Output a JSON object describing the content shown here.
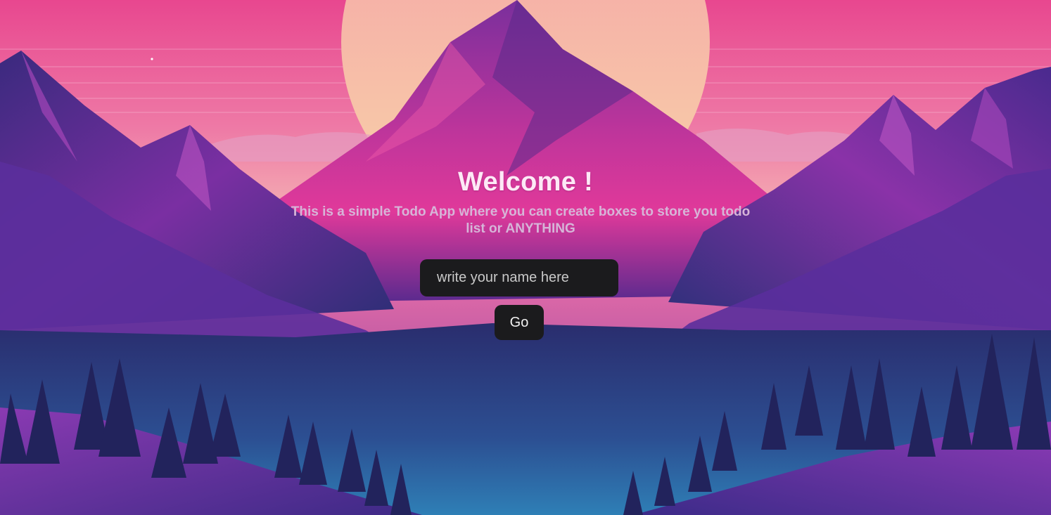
{
  "hero": {
    "title": "Welcome !",
    "subtitle": "This is a simple Todo App where you can create boxes to store you todo list or ANYTHING"
  },
  "form": {
    "name_placeholder": "write your name here",
    "name_value": "",
    "go_label": "Go"
  },
  "colors": {
    "sky_top": "#e84c96",
    "sky_mid": "#f08ab0",
    "sun": "#f7cba6",
    "mountain_purple": "#6a2a9a",
    "mountain_magenta": "#d63a9a",
    "valley_blue": "#2b5fa0",
    "forest_dark": "#1e2356",
    "control_bg": "#1b1b1d"
  },
  "background": {
    "scene": "mountain-sunset-illustration"
  }
}
